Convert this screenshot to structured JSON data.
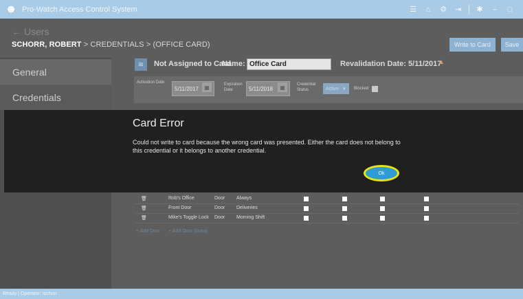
{
  "app": {
    "title": "Pro-Watch Access Control System",
    "logo_icon": "user-logo-icon",
    "titlebar_icons": [
      "menu-icon",
      "home-icon",
      "gear-icon",
      "logout-icon",
      "settings-icon",
      "minimize-icon",
      "maximize-icon"
    ]
  },
  "header": {
    "back_label": "← Users",
    "breadcrumb": {
      "person": "SCHORR, ROBERT",
      "sep1": ">",
      "section": "CREDENTIALS",
      "sep2": ">",
      "item": "(OFFICE CARD)"
    },
    "write_button": "Write to Card",
    "save_button": "Save"
  },
  "sidebar": {
    "items": [
      {
        "label": "General"
      },
      {
        "label": "Credentials"
      }
    ]
  },
  "credential": {
    "status_title": "Not Assigned to Card",
    "name_label": "Name:",
    "name_value": "Office Card",
    "revalidation": "Revalidation Date: 5/11/2017",
    "activation_label": "Activation Date",
    "activation_value": "5/11/2017",
    "expiration_label": "Expiration Date",
    "expiration_value": "5/11/2018",
    "status_label": "Credential Status",
    "status_value": "Active",
    "blocked_label": "Blocked"
  },
  "dialog": {
    "title": "Card Error",
    "message": "Could not write to card because the wrong card was presented. Either the card does not belong to this credential or it belongs to another credential.",
    "ok_label": "Ok"
  },
  "table": {
    "rows": [
      {
        "name": "Rob's Office",
        "type": "Door",
        "schedule": "Always"
      },
      {
        "name": "Front Door",
        "type": "Door",
        "schedule": "Deliveries"
      },
      {
        "name": "Mike's Toggle Lock",
        "type": "Door",
        "schedule": "Morning Shift"
      }
    ],
    "add_door": "+ Add Door",
    "add_door_group": "+ Add Door Group"
  },
  "statusbar": {
    "text": "Ready | Operator: rschorr"
  }
}
